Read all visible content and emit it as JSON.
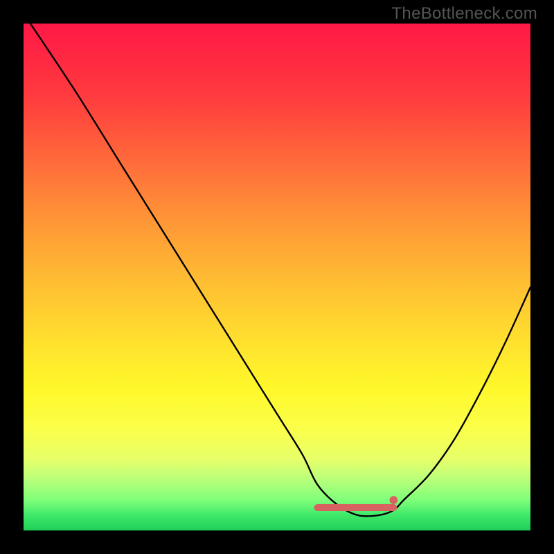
{
  "watermark": {
    "text": "TheBottleneck.com"
  },
  "chart_data": {
    "type": "line",
    "title": "",
    "xlabel": "",
    "ylabel": "",
    "xlim": [
      0,
      1
    ],
    "ylim": [
      0,
      1
    ],
    "series": [
      {
        "name": "curve",
        "x": [
          0.0,
          0.1,
          0.2,
          0.3,
          0.4,
          0.5,
          0.55,
          0.58,
          0.62,
          0.66,
          0.7,
          0.73,
          0.75,
          0.8,
          0.85,
          0.9,
          0.95,
          1.0
        ],
        "values": [
          1.02,
          0.87,
          0.71,
          0.55,
          0.39,
          0.23,
          0.15,
          0.09,
          0.05,
          0.03,
          0.03,
          0.04,
          0.06,
          0.11,
          0.18,
          0.27,
          0.37,
          0.48
        ]
      }
    ],
    "trough_segment": {
      "start_x": 0.58,
      "end_x": 0.73,
      "y": 0.045,
      "color": "#d8625f"
    },
    "trough_end_marker": {
      "x": 0.73,
      "y": 0.06,
      "r": 0.008,
      "color": "#d8625f"
    },
    "background_gradient": {
      "top": "#ff1846",
      "bottom": "#1ecf58"
    }
  }
}
